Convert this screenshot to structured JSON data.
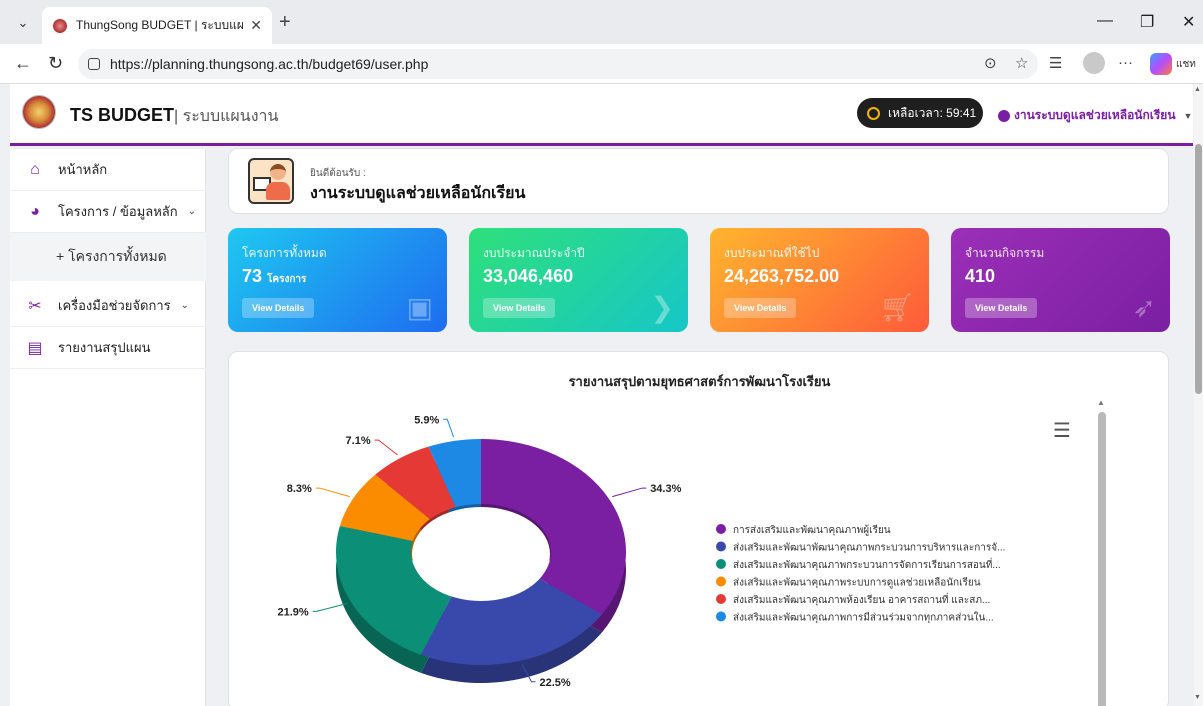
{
  "browser": {
    "tab_title": "ThungSong BUDGET | ระบบแผนงาน",
    "url": "https://planning.thungsong.ac.th/budget69/user.php",
    "copilot_label": "แชท"
  },
  "header": {
    "brand": "TS BUDGET",
    "brand_sub": "| ระบบแผนงาน",
    "timer": "เหลือเวลา: 59:41",
    "user": "งานระบบดูแลช่วยเหลือนักเรียน"
  },
  "sidebar": {
    "items": [
      {
        "label": "หน้าหลัก",
        "icon": "home-icon"
      },
      {
        "label": "โครงการ / ข้อมูลหลัก",
        "icon": "pie-icon"
      },
      {
        "label": "+ โครงการทั้งหมด"
      },
      {
        "label": "เครื่องมือช่วยจัดการ",
        "icon": "tools-icon"
      },
      {
        "label": "รายงานสรุปแผน",
        "icon": "document-icon"
      }
    ]
  },
  "welcome": {
    "greeting": "ยินดีต้อนรับ :",
    "name": "งานระบบดูแลช่วยเหลือนักเรียน"
  },
  "cards": [
    {
      "label": "โครงการทั้งหมด",
      "value": "73",
      "unit": "โครงการ",
      "button": "View Details",
      "icon": "briefcase-icon"
    },
    {
      "label": "งบประมาณประจำปี",
      "value": "33,046,460",
      "unit": "",
      "button": "View Details",
      "icon": "chevron-right-icon"
    },
    {
      "label": "งบประมาณที่ใช้ไป",
      "value": "24,263,752.00",
      "unit": "",
      "button": "View Details",
      "icon": "cart-icon"
    },
    {
      "label": "จำนวนกิจกรรม",
      "value": "410",
      "unit": "",
      "button": "View Details",
      "icon": "rocket-icon"
    }
  ],
  "chart_data": {
    "type": "pie",
    "title": "รายงานสรุปตามยุทธศาสตร์การพัฒนาโรงเรียน",
    "legend_position": "right",
    "series": [
      {
        "name": "การส่งเสริมและพัฒนาคุณภาพผู้เรียน",
        "value": 34.3,
        "label": "34.3%",
        "color": "#7b1fa2"
      },
      {
        "name": "ส่งเสริมและพัฒนาพัฒนาคุณภาพกระบวนการบริหารและการจั...",
        "value": 22.5,
        "label": "22.5%",
        "color": "#3949ab"
      },
      {
        "name": "ส่งเสริมและพัฒนาคุณภาพกระบวนการจัดการเรียนการสอนที่...",
        "value": 21.9,
        "label": "21.9%",
        "color": "#0b8f76"
      },
      {
        "name": "ส่งเสริมและพัฒนาคุณภาพระบบการดูแลช่วยเหลือนักเรียน",
        "value": 8.3,
        "label": "8.3%",
        "color": "#fb8c00"
      },
      {
        "name": "ส่งเสริมและพัฒนาคุณภาพห้องเรียน อาคารสถานที่ และสภ...",
        "value": 7.1,
        "label": "7.1%",
        "color": "#e53935"
      },
      {
        "name": "ส่งเสริมและพัฒนาคุณภาพการมีส่วนร่วมจากทุกภาคส่วนใน...",
        "value": 5.9,
        "label": "5.9%",
        "color": "#1e88e5"
      }
    ]
  }
}
